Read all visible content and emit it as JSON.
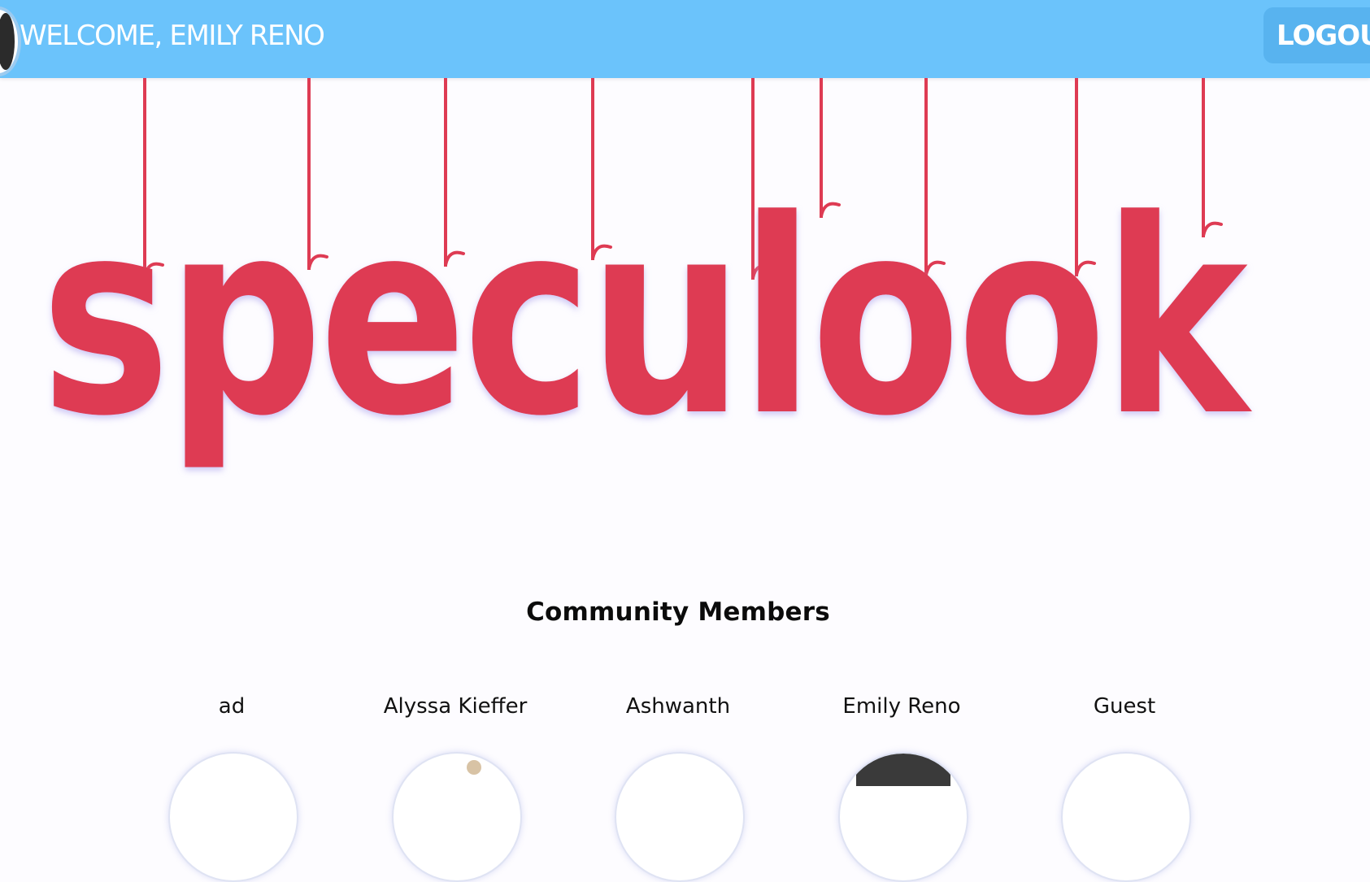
{
  "header": {
    "welcome_text": "WELCOME, EMILY RENO",
    "logout_label": "LOGOUT",
    "colors": {
      "bar": "#6bc3fb",
      "logout_button": "#58b3ef",
      "text": "#ffffff"
    }
  },
  "logo": {
    "text": "speculook",
    "colors": {
      "letters": "#de3b53",
      "strings": "#de3b53",
      "glow": "#c9c2f4"
    }
  },
  "community": {
    "title": "Community Members",
    "members": [
      {
        "name": "ad",
        "avatar": "avatar-icon"
      },
      {
        "name": "Alyssa Kieffer",
        "avatar": "photo-avatar"
      },
      {
        "name": "Ashwanth",
        "avatar": "avatar-icon"
      },
      {
        "name": "Emily Reno",
        "avatar": "photo-avatar"
      },
      {
        "name": "Guest",
        "avatar": "avatar-icon"
      }
    ]
  }
}
